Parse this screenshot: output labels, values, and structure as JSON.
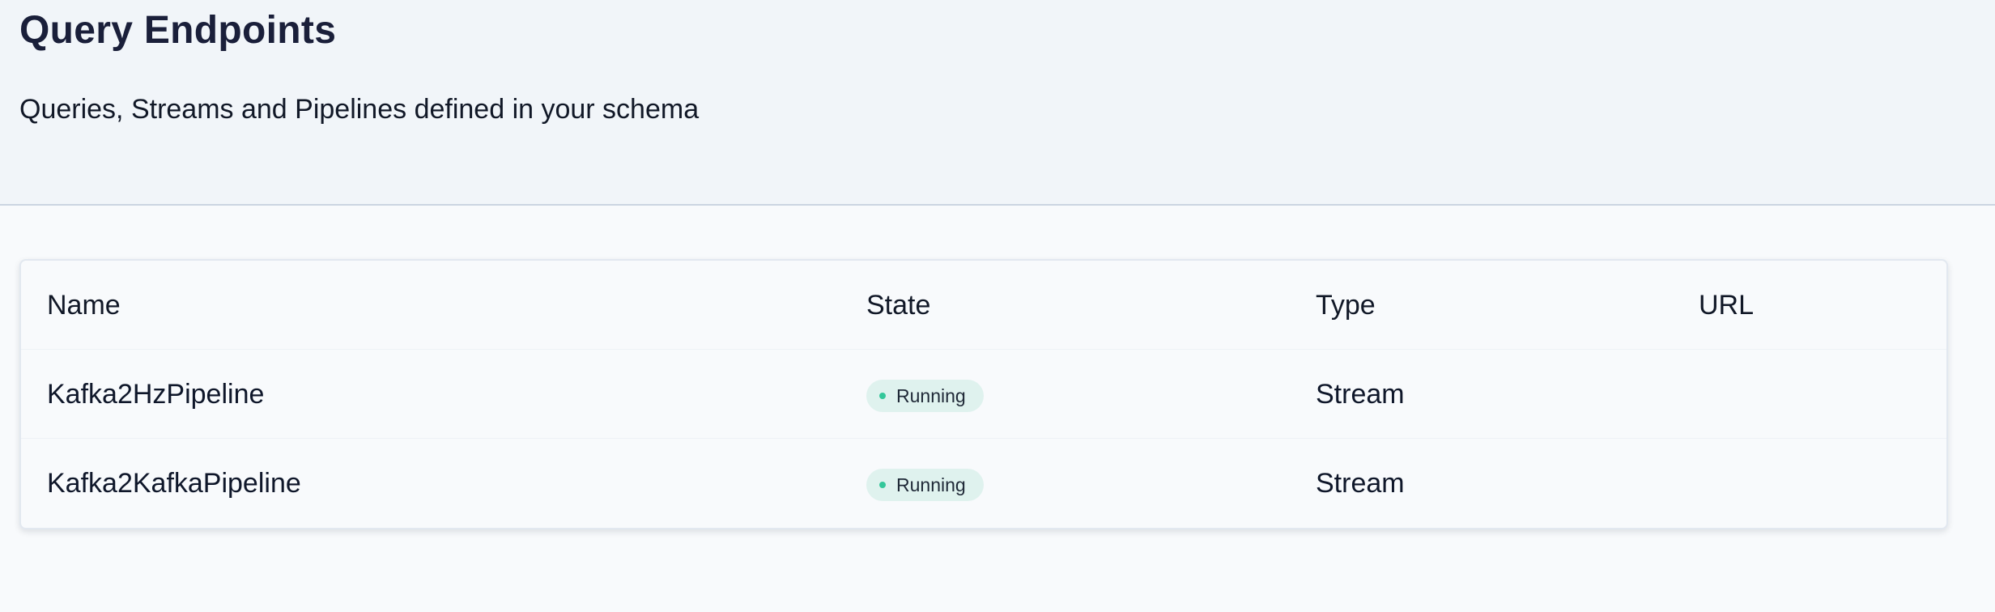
{
  "header": {
    "title": "Query Endpoints",
    "subtitle": "Queries, Streams and Pipelines defined in your schema"
  },
  "table": {
    "columns": [
      "Name",
      "State",
      "Type",
      "URL"
    ],
    "rows": [
      {
        "name": "Kafka2HzPipeline",
        "state": "Running",
        "type": "Stream",
        "url": ""
      },
      {
        "name": "Kafka2KafkaPipeline",
        "state": "Running",
        "type": "Stream",
        "url": ""
      }
    ]
  },
  "colors": {
    "header_bg": "#f1f5f9",
    "page_bg": "#f8fafc",
    "badge_bg": "#dff2ee",
    "status_running": "#34c79a"
  },
  "icons": {
    "status_indicator": "status-dot-icon"
  }
}
